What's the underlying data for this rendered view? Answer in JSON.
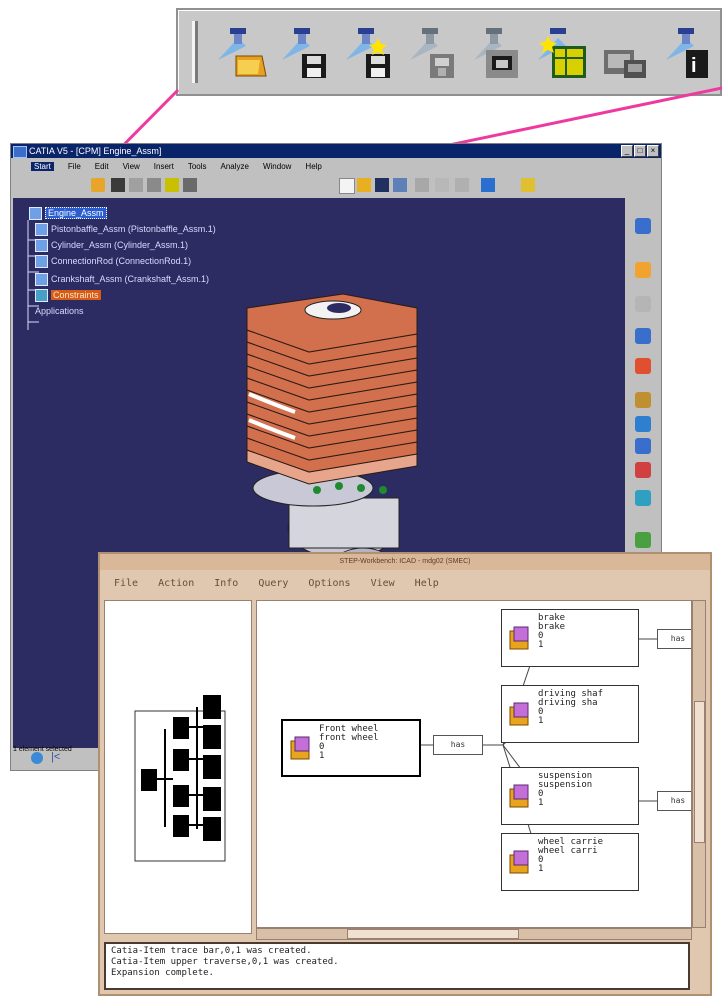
{
  "catia_window": {
    "title": "CATIA V5 - [CPM] Engine_Assm]",
    "menu": [
      "Start",
      "File",
      "Edit",
      "View",
      "Insert",
      "Tools",
      "Analyze",
      "Window",
      "Help"
    ],
    "tree": {
      "root": "Engine_Assm",
      "children": [
        "Pistonbaffle_Assm (Pistonbaffle_Assm.1)",
        "Cylinder_Assm (Cylinder_Assm.1)",
        "ConnectionRod (ConnectionRod.1)",
        "Crankshaft_Assm (Crankshaft_Assm.1)",
        "Constraints",
        "Applications"
      ]
    },
    "status": "1 element selected"
  },
  "magnified_toolbar": {
    "icons": [
      "open-icon",
      "save-icon",
      "new-save-icon",
      "export-icon",
      "save-as-icon",
      "new-document-icon",
      "copy-view-icon",
      "properties-icon"
    ]
  },
  "schema_window": {
    "title": "STEP-Workbench: ICAD - mdg02 (SMEC)",
    "menu": [
      "File",
      "Action",
      "Info",
      "Query",
      "Options",
      "View",
      "Help"
    ],
    "root_node": [
      "Front wheel",
      "front wheel",
      "0",
      "1"
    ],
    "has_labels": [
      "has",
      "has",
      "has"
    ],
    "child_nodes": [
      [
        "brake",
        "brake",
        "0",
        "1"
      ],
      [
        "driving shaf",
        "driving sha",
        "0",
        "1"
      ],
      [
        "suspension",
        "suspension",
        "0",
        "1"
      ],
      [
        "wheel carrie",
        "wheel carri",
        "0",
        "1"
      ]
    ],
    "console": [
      "Catia-Item trace bar,0,1 was created.",
      "Catia-Item upper traverse,0,1 was created.",
      "Expansion complete."
    ]
  },
  "colors": {
    "connector": "#ee3aa0",
    "viewport": "#2c2c63",
    "cylinder_fins": "#d2704d",
    "schema_frame": "#e0c8b0"
  }
}
